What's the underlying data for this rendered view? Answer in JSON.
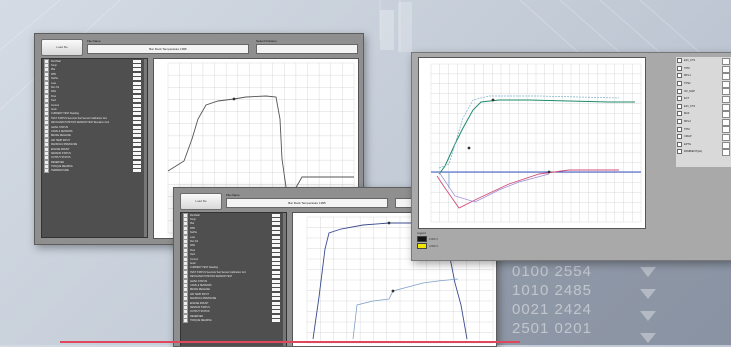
{
  "window1": {
    "load_button": "Load file",
    "file_label": "File Name",
    "file_value": "Bar Rock Temperature 1995",
    "section_label": "Search Params",
    "params": [
      "Run/Stall",
      "Temp",
      "Plat",
      "RPM",
      "SwPos",
      "Load",
      "Run Tot",
      "RAM",
      "Flow",
      "Tach",
      "Current",
      "Auxin",
      "CURRENT TEST Reading",
      "TEST STATUS Seconds Test Sensor Calibration Grid",
      "REVOLVER POSITION SENSOR TEST Elevation Grid",
      "LEVEL STATUS",
      "CAMS & SENSORS",
      "BRAKE RELEASE",
      "AIR TEMP INPUT",
      "MANIFOLD PRESSURE",
      "ENGINE MOUNT",
      "SENSOR STATUS",
      "OUTPUT STATUS",
      "RESERVED",
      "TORQUE READING",
      "TEMPERATURE"
    ]
  },
  "window2": {
    "load_button": "Load file",
    "file_label": "File Name",
    "file_value": "Bar Rock Temperature 1995",
    "params": [
      "Run/Stall",
      "Temp",
      "Plat",
      "RPM",
      "SwPos",
      "Load",
      "Run Tot",
      "RAM",
      "Flow",
      "Tach",
      "Current",
      "Auxin",
      "CURRENT TEST Reading",
      "TEST STATUS Seconds Test Sensor Calibration Grid",
      "REVOLVER POSITION SENSOR TEST",
      "LEVEL STATUS",
      "CAMS & SENSORS",
      "BRAKE RELEASE",
      "AIR TEMP INPUT",
      "MANIFOLD PRESSURE",
      "ENGINE MOUNT",
      "SENSOR STATUS",
      "OUTPUT STATUS",
      "RESERVED",
      "TORQUE READING"
    ]
  },
  "window3": {
    "series_list": [
      "EIO_CTS",
      "TPM",
      "MPL1",
      "TPS2",
      "IAT_MAP",
      "ECT",
      "EIO_CTS",
      "MAF",
      "MPL2",
      "TPM",
      "CMAP",
      "EPTG",
      "PAMBIENT(psi)"
    ],
    "legend_title": "Legend",
    "legend_values": [
      "0.000 V",
      "0.000 V"
    ],
    "legend_colors": [
      "#111111",
      "#f2e600"
    ]
  },
  "colors": {
    "accent_red": "#e0475c"
  },
  "background_numbers": [
    "0100 2554",
    "1010 2485",
    "0021 2424",
    "2501 0201"
  ]
}
